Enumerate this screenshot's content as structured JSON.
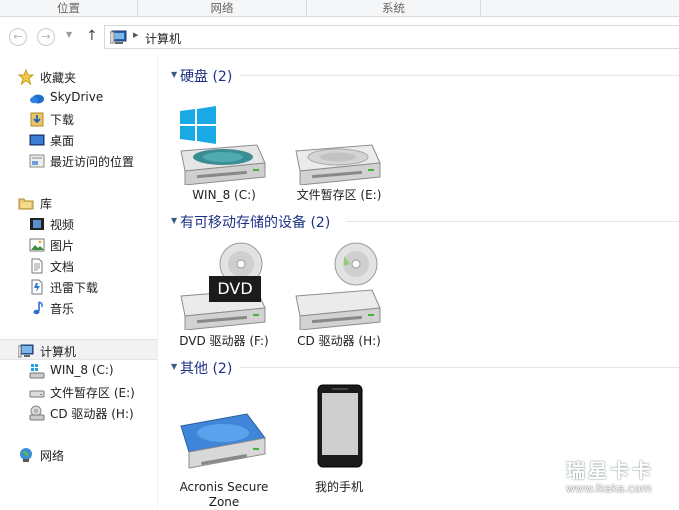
{
  "ribbon": {
    "tabs": [
      "位置",
      "网络",
      "系统"
    ]
  },
  "address": {
    "path": "计算机"
  },
  "sidebar": {
    "favorites": {
      "label": "收藏夹",
      "items": [
        "SkyDrive",
        "下载",
        "桌面",
        "最近访问的位置"
      ]
    },
    "libraries": {
      "label": "库",
      "items": [
        "视频",
        "图片",
        "文档",
        "迅雷下载",
        "音乐"
      ]
    },
    "computer": {
      "label": "计算机",
      "items": [
        "WIN_8 (C:)",
        "文件暂存区 (E:)",
        "CD 驱动器 (H:)"
      ]
    },
    "network": {
      "label": "网络"
    }
  },
  "groups": {
    "hdd": {
      "title": "硬盘 (2)",
      "items": [
        "WIN_8 (C:)",
        "文件暂存区 (E:)"
      ]
    },
    "removable": {
      "title": "有可移动存储的设备 (2)",
      "items": [
        "DVD 驱动器 (F:)",
        "CD 驱动器 (H:)"
      ]
    },
    "other": {
      "title": "其他 (2)",
      "items": [
        "Acronis Secure Zone",
        "我的手机"
      ]
    }
  },
  "dvd_badge": "DVD",
  "watermark": {
    "big": "瑞星卡卡",
    "small": "www.ikaka.com"
  }
}
